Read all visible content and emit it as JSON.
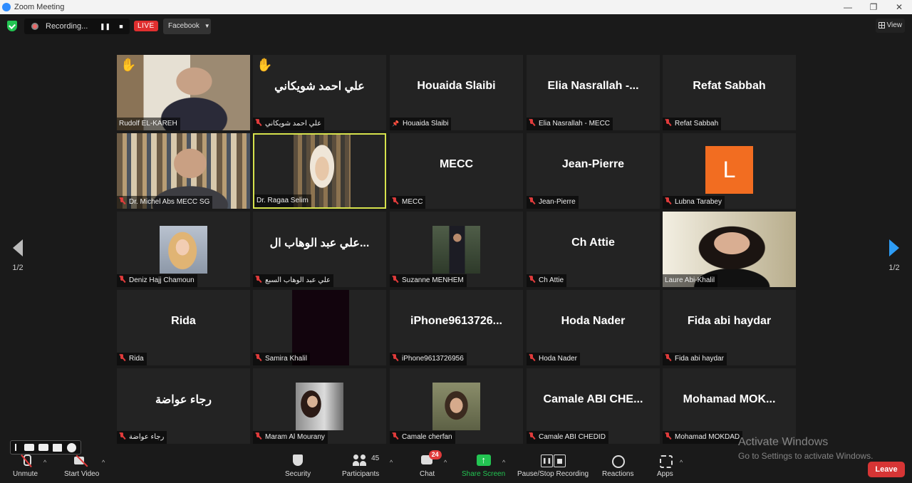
{
  "window": {
    "title": "Zoom Meeting",
    "minimize": "—",
    "maximize": "❐",
    "close": "✕"
  },
  "topbar": {
    "recording_label": "Recording...",
    "live_label": "LIVE",
    "stream_target": "Facebook",
    "view_label": "View"
  },
  "nav": {
    "page_left": "1/2",
    "page_right": "1/2"
  },
  "tiles": [
    {
      "display": "",
      "label": "Rudolf EL-KAREH",
      "hand": true,
      "video": "v-face1",
      "muted": false
    },
    {
      "display": "علي احمد شويكاني",
      "label": "علي احمد شويكاني",
      "hand": true,
      "muted": true
    },
    {
      "display": "Houaida Slaibi",
      "label": "Houaida Slaibi",
      "pinned": true
    },
    {
      "display": "Elia  Nasrallah  -...",
      "label": "Elia Nasrallah - MECC",
      "muted": true
    },
    {
      "display": "Refat Sabbah",
      "label": "Refat Sabbah",
      "muted": true
    },
    {
      "display": "",
      "label": "Dr. Michel Abs MECC SG",
      "video": "v-face2",
      "muted": true
    },
    {
      "display": "",
      "label": "Dr. Ragaa Selim",
      "video": "v-face3",
      "active": true
    },
    {
      "display": "MECC",
      "label": "MECC",
      "muted": true
    },
    {
      "display": "Jean-Pierre",
      "label": "Jean-Pierre",
      "muted": true
    },
    {
      "display": "",
      "label": "Lubna Tarabey",
      "avatar_letter": "L",
      "muted": true
    },
    {
      "display": "",
      "label": "Deniz Hajj Chamoun",
      "video": "v-face4",
      "muted": true
    },
    {
      "display": "علي عبد الوهاب ال...",
      "label": "علي عبد الوهاب السبع",
      "muted": true
    },
    {
      "display": "",
      "label": "Suzanne MENHEM",
      "video": "v-face5",
      "muted": true
    },
    {
      "display": "Ch Attie",
      "label": "Ch Attie",
      "muted": true
    },
    {
      "display": "",
      "label": "Laure Abi-Khalil",
      "video": "v-face6"
    },
    {
      "display": "Rida",
      "label": "Rida",
      "muted": true
    },
    {
      "display": "",
      "label": "Samira Khalil",
      "video": "v-dark",
      "muted": true
    },
    {
      "display": "iPhone9613726...",
      "label": "iPhone9613726956",
      "muted": true
    },
    {
      "display": "Hoda Nader",
      "label": "Hoda Nader",
      "muted": true
    },
    {
      "display": "Fida abi haydar",
      "label": "Fida abi haydar",
      "muted": true
    },
    {
      "display": "رجاء عواضة",
      "label": "رجاء عواضة",
      "muted": true
    },
    {
      "display": "",
      "label": "Maram Al Mourany",
      "video": "v-face7",
      "muted": true
    },
    {
      "display": "",
      "label": "Camale cherfan",
      "video": "v-face8",
      "muted": true
    },
    {
      "display": "Camale  ABI  CHE...",
      "label": "Camale ABI CHEDID",
      "muted": true
    },
    {
      "display": "Mohamad  MOK...",
      "label": "Mohamad MOKDAD",
      "muted": true
    }
  ],
  "toolbar": {
    "unmute": "Unmute",
    "start_video": "Start Video",
    "security": "Security",
    "participants": "Participants",
    "participants_count": "45",
    "chat": "Chat",
    "chat_badge": "24",
    "share_screen": "Share Screen",
    "pause_stop_recording": "Pause/Stop Recording",
    "reactions": "Reactions",
    "apps": "Apps",
    "leave": "Leave",
    "caret": "^"
  },
  "watermark": {
    "line1": "Activate Windows",
    "line2": "Go to Settings to activate Windows."
  },
  "colors": {
    "share_green": "#23c552",
    "leave_red": "#d63535",
    "active_speaker": "#d6e24c",
    "avatar_orange": "#f26d21"
  }
}
